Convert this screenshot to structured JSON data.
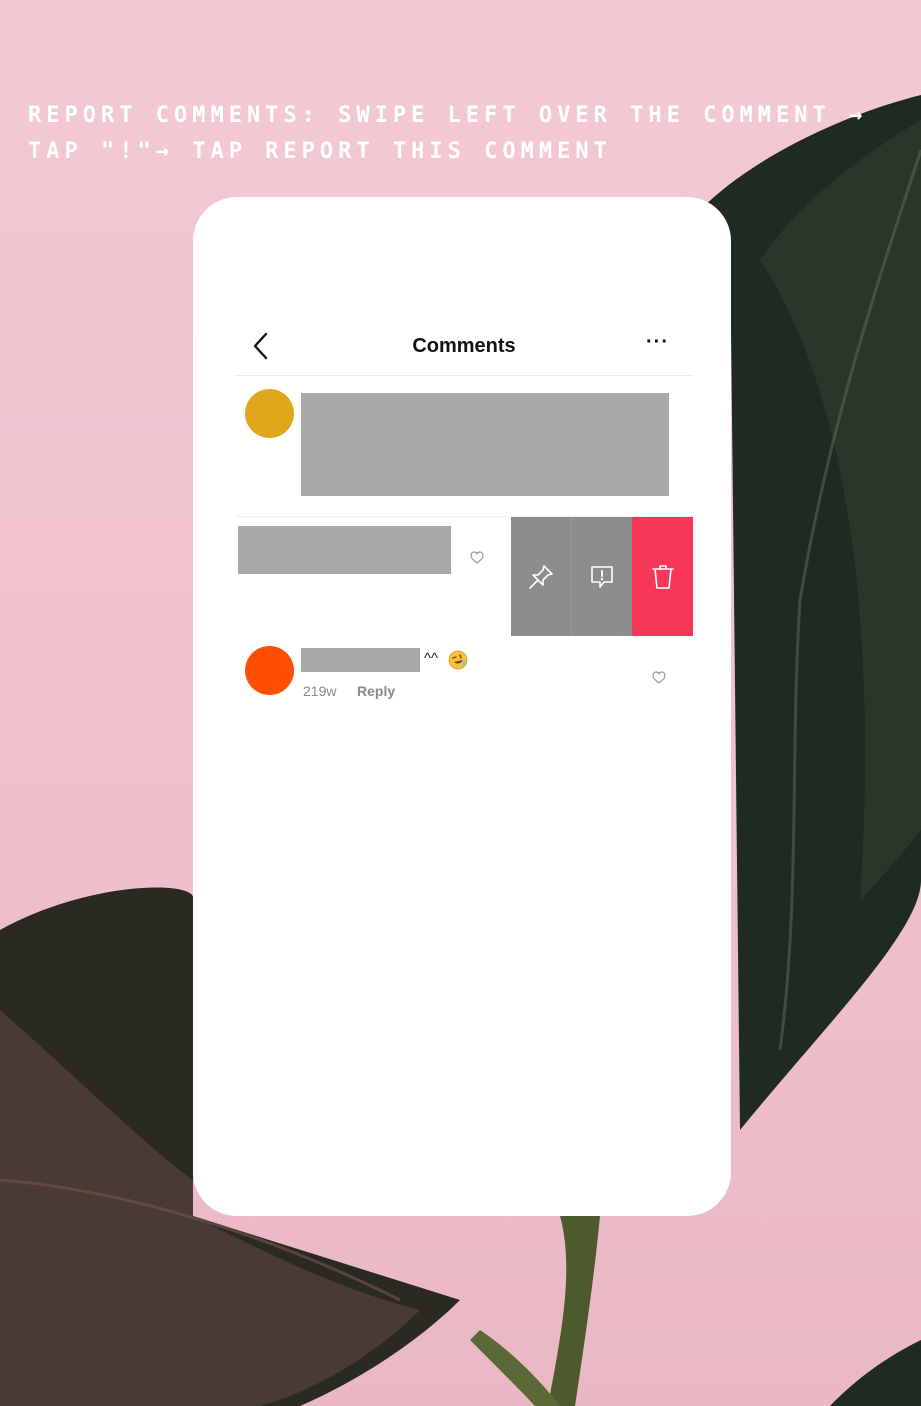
{
  "caption": "Report comments: swipe left over the comment → tap \"!\"→ tap report this comment",
  "comments_screen": {
    "title": "Comments",
    "more_label": "···",
    "second_comment": {
      "text_suffix": "^^",
      "time": "219w",
      "reply_label": "Reply"
    }
  },
  "icons": {
    "back": "chevron-left-icon",
    "more": "more-icon",
    "heart": "heart-icon",
    "pin": "pin-icon",
    "report": "report-icon",
    "delete": "trash-icon",
    "emoji": "rofl-emoji-icon"
  },
  "colors": {
    "background": "#f0c4cf",
    "avatar_1": "#dfa81c",
    "avatar_2": "#ff4f05",
    "action_gray": "#8d8d8d",
    "action_delete": "#f7375a",
    "redaction": "#a9a9a9"
  }
}
